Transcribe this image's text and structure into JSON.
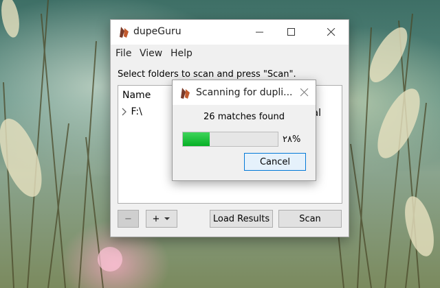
{
  "main": {
    "title": "dupeGuru",
    "menu": [
      "File",
      "View",
      "Help"
    ],
    "instruction": "Select folders to scan and press \"Scan\".",
    "columns": [
      "Name",
      ""
    ],
    "folders": [
      {
        "path": "F:\\",
        "state": "al"
      }
    ],
    "buttons": {
      "remove": "−",
      "add": "+",
      "load_results": "Load Results",
      "scan": "Scan"
    }
  },
  "dialog": {
    "title": "Scanning for dupli...",
    "matches": "26 matches found",
    "progress_text": "٢٨%",
    "progress_fraction": 0.28,
    "cancel_label": "Cancel"
  },
  "icons": {
    "app": "dupeguru-icon",
    "expand": "chevron-right-icon",
    "dropdown": "caret-down-icon"
  },
  "colors": {
    "progress": "#06b025",
    "focus": "#0078d7"
  }
}
